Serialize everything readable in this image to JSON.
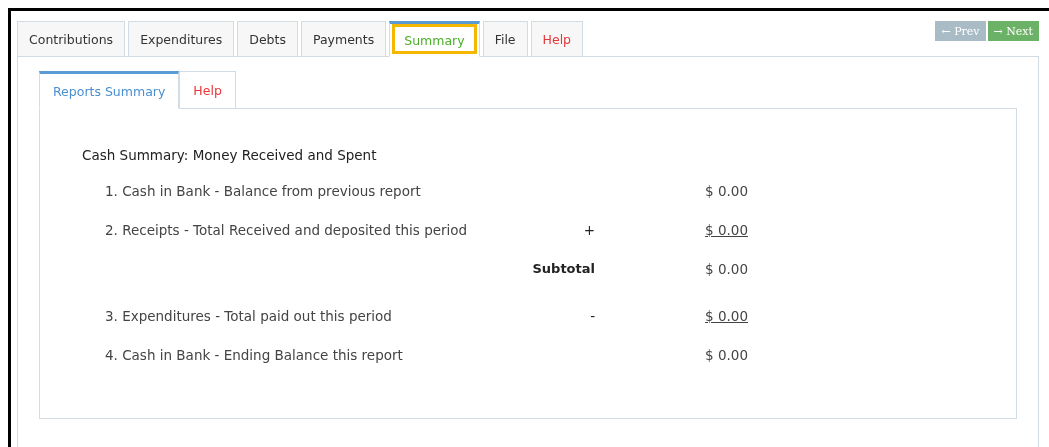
{
  "tabs": [
    {
      "label": "Contributions",
      "kind": "normal",
      "selected": false,
      "highlighted": false
    },
    {
      "label": "Expenditures",
      "kind": "normal",
      "selected": false,
      "highlighted": false
    },
    {
      "label": "Debts",
      "kind": "normal",
      "selected": false,
      "highlighted": false
    },
    {
      "label": "Payments",
      "kind": "normal",
      "selected": false,
      "highlighted": false
    },
    {
      "label": "Summary",
      "kind": "normal",
      "selected": true,
      "highlighted": true
    },
    {
      "label": "File",
      "kind": "normal",
      "selected": false,
      "highlighted": false
    },
    {
      "label": "Help",
      "kind": "help",
      "selected": false,
      "highlighted": false
    }
  ],
  "nav": {
    "prev": {
      "arrow": "←",
      "label": "Prev",
      "disabled": true
    },
    "next": {
      "arrow": "→",
      "label": "Next",
      "disabled": false
    }
  },
  "subtabs": [
    {
      "label": "Reports Summary",
      "kind": "normal",
      "selected": true
    },
    {
      "label": "Help",
      "kind": "help",
      "selected": false
    }
  ],
  "summary": {
    "title": "Cash Summary: Money Received and Spent",
    "rows": [
      {
        "kind": "item",
        "label": "1. Cash in Bank - Balance from previous report",
        "amount": "$ 0.00",
        "underlined": false
      },
      {
        "kind": "item",
        "label": "2. Receipts - Total Received and deposited this period",
        "sign": "+",
        "amount": "$ 0.00",
        "underlined": true
      },
      {
        "kind": "subtotal",
        "caption": "Subtotal",
        "amount": "$ 0.00",
        "underlined": false
      },
      {
        "kind": "item",
        "label": "3. Expenditures - Total paid out this period",
        "sign": "-",
        "amount": "$ 0.00",
        "underlined": true
      },
      {
        "kind": "item",
        "label": "4. Cash in Bank - Ending Balance this report",
        "amount": "$ 0.00",
        "underlined": false
      }
    ]
  }
}
